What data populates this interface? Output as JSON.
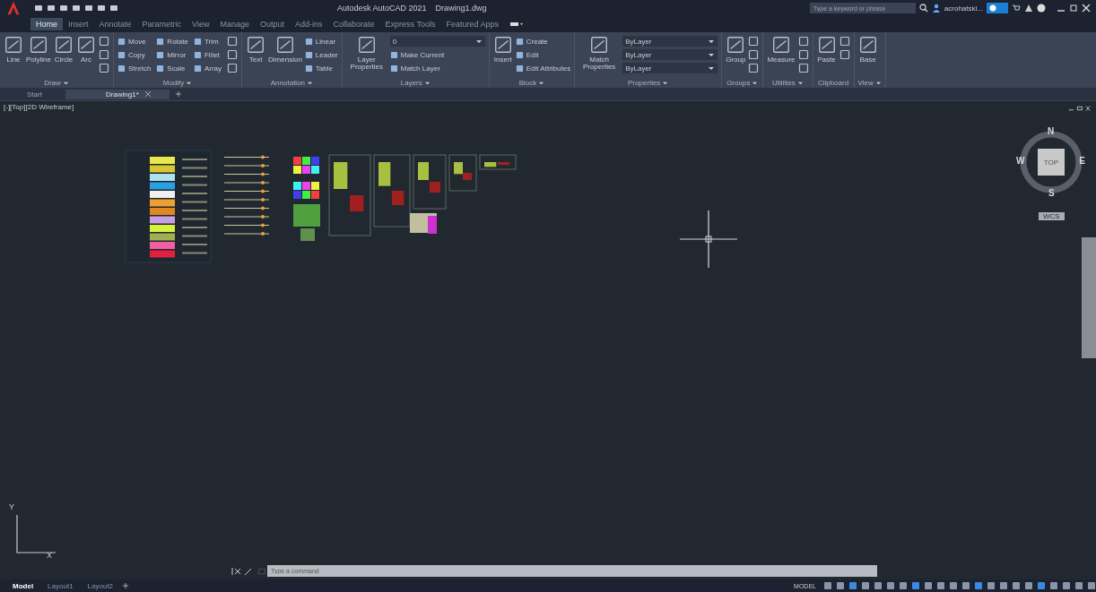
{
  "title_bar": {
    "title": "Autodesk AutoCAD 2021",
    "document": "Drawing1.dwg",
    "search": {
      "placeholder": "Type a keyword or phrase"
    },
    "user": "acrohatski..."
  },
  "ribbon_tabs": [
    {
      "label": "Home",
      "selected": true
    },
    {
      "label": "Insert",
      "selected": false
    },
    {
      "label": "Annotate",
      "selected": false
    },
    {
      "label": "Parametric",
      "selected": false
    },
    {
      "label": "View",
      "selected": false
    },
    {
      "label": "Manage",
      "selected": false
    },
    {
      "label": "Output",
      "selected": false
    },
    {
      "label": "Add-ins",
      "selected": false
    },
    {
      "label": "Collaborate",
      "selected": false
    },
    {
      "label": "Express Tools",
      "selected": false
    },
    {
      "label": "Featured Apps",
      "selected": false
    }
  ],
  "panels": [
    {
      "title": "Draw",
      "menu": true,
      "tools": [
        {
          "kind": "large",
          "label": "Line"
        },
        {
          "kind": "large",
          "label": "Polyline"
        },
        {
          "kind": "large",
          "label": "Circle"
        },
        {
          "kind": "large",
          "label": "Arc"
        },
        {
          "kind": "icon"
        },
        {
          "kind": "icon"
        },
        {
          "kind": "icon"
        }
      ]
    },
    {
      "title": "Modify",
      "menu": true,
      "tools": [
        {
          "kind": "small",
          "label": "Move"
        },
        {
          "kind": "small",
          "label": "Copy"
        },
        {
          "kind": "small",
          "label": "Stretch"
        },
        {
          "kind": "small",
          "label": "Rotate"
        },
        {
          "kind": "small",
          "label": "Mirror"
        },
        {
          "kind": "small",
          "label": "Scale"
        },
        {
          "kind": "small",
          "label": "Trim"
        },
        {
          "kind": "small",
          "label": "Fillet"
        },
        {
          "kind": "small",
          "label": "Array"
        },
        {
          "kind": "icon"
        },
        {
          "kind": "icon"
        },
        {
          "kind": "icon"
        }
      ]
    },
    {
      "title": "Annotation",
      "menu": true,
      "tools": [
        {
          "kind": "large",
          "label": "Text"
        },
        {
          "kind": "large",
          "label": "Dimension"
        },
        {
          "kind": "small",
          "label": "Linear"
        },
        {
          "kind": "small",
          "label": "Leader"
        },
        {
          "kind": "small",
          "label": "Table"
        }
      ]
    },
    {
      "title": "Layers",
      "menu": true,
      "tools": [
        {
          "kind": "large",
          "label": "Layer Properties"
        },
        {
          "kind": "dropdown",
          "value": "0"
        },
        {
          "kind": "small",
          "label": "Make Current"
        },
        {
          "kind": "small",
          "label": "Match Layer"
        }
      ]
    },
    {
      "title": "Block",
      "menu": true,
      "tools": [
        {
          "kind": "large",
          "label": "Insert"
        },
        {
          "kind": "small",
          "label": "Create"
        },
        {
          "kind": "small",
          "label": "Edit"
        },
        {
          "kind": "small",
          "label": "Edit Attributes"
        }
      ]
    },
    {
      "title": "Properties",
      "menu": true,
      "tools": [
        {
          "kind": "large",
          "label": "Match Properties"
        },
        {
          "kind": "dropdown",
          "value": "ByLayer"
        },
        {
          "kind": "dropdown",
          "value": "ByLayer"
        },
        {
          "kind": "dropdown",
          "value": "ByLayer"
        }
      ]
    },
    {
      "title": "Groups",
      "menu": true,
      "tools": [
        {
          "kind": "large",
          "label": "Group"
        },
        {
          "kind": "icon"
        },
        {
          "kind": "icon"
        },
        {
          "kind": "icon"
        }
      ]
    },
    {
      "title": "Utilities",
      "menu": true,
      "tools": [
        {
          "kind": "large",
          "label": "Measure"
        },
        {
          "kind": "icon"
        },
        {
          "kind": "icon"
        },
        {
          "kind": "icon"
        }
      ]
    },
    {
      "title": "Clipboard",
      "menu": false,
      "tools": [
        {
          "kind": "large",
          "label": "Paste"
        },
        {
          "kind": "icon"
        },
        {
          "kind": "icon"
        }
      ]
    },
    {
      "title": "View",
      "menu": true,
      "tools": [
        {
          "kind": "large",
          "label": "Base"
        }
      ]
    }
  ],
  "file_tabs": [
    {
      "label": "Start",
      "selected": false,
      "closable": false
    },
    {
      "label": "Drawing1*",
      "selected": true,
      "closable": true
    }
  ],
  "viewport": {
    "label": "[-][Top][2D Wireframe]",
    "viewcube": {
      "face": "TOP",
      "north": "N",
      "south": "S",
      "east": "E",
      "west": "W",
      "ucs": "WCS"
    },
    "axes": {
      "x": "X",
      "y": "Y"
    }
  },
  "command_line": {
    "placeholder": "Type a command"
  },
  "layout_tabs": [
    {
      "label": "Model",
      "selected": true
    },
    {
      "label": "Layout1",
      "selected": false
    },
    {
      "label": "Layout2",
      "selected": false
    }
  ],
  "status_bar": {
    "mode": "MODEL"
  }
}
